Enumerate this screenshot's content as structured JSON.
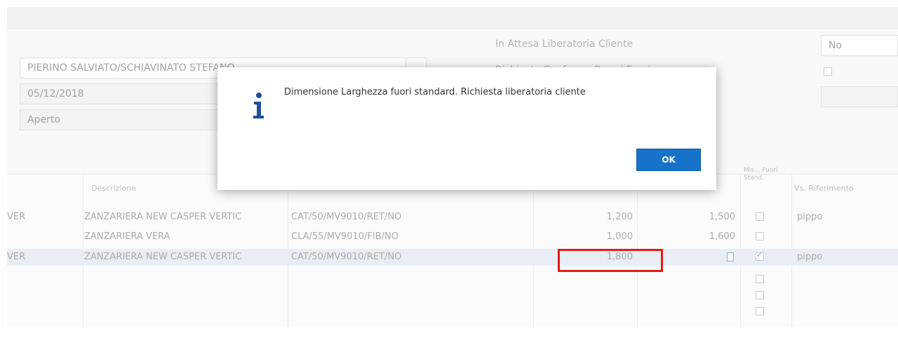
{
  "header": {
    "customer": "PIERINO SALVIATO/SCHIAVINATO STEFANO",
    "date": "05/12/2018",
    "status": "Aperto",
    "label_pending_release": "In Attesa Liberatoria Cliente",
    "label_hidden": "Richiesta Conferma Prezzi Fuori",
    "pending_release_value": "No"
  },
  "grid": {
    "headers": {
      "description": "Descrizione",
      "out_of_std": "Mis... Fuori Stand.",
      "reference": "Vs. Riferimento"
    },
    "rows": [
      {
        "code_prefix": "VER",
        "description": "ZANZARIERA NEW CASPER VERTIC",
        "variant": "CAT/50/MV9010/RET/NO",
        "width": "1,200",
        "height": "1,500",
        "out_of_std": false,
        "reference": "pippo"
      },
      {
        "code_prefix": "",
        "description": "ZANZARIERA VERA",
        "variant": "CLA/55/MV9010/FIB/NO",
        "width": "1,000",
        "height": "1,600",
        "out_of_std": false,
        "reference": ""
      },
      {
        "code_prefix": "VER",
        "description": "ZANZARIERA NEW CASPER VERTIC",
        "variant": "CAT/50/MV9010/RET/NO",
        "width": "1,800",
        "height": "",
        "out_of_std": true,
        "reference": "pippo"
      }
    ]
  },
  "dialog": {
    "icon": "info-icon",
    "message": "Dimensione Larghezza fuori standard. Richiesta liberatoria cliente",
    "ok_label": "OK"
  },
  "colors": {
    "ok_button": "#1673c9",
    "highlight": "#e21b1b",
    "selected_row": "#d6e0ec"
  }
}
